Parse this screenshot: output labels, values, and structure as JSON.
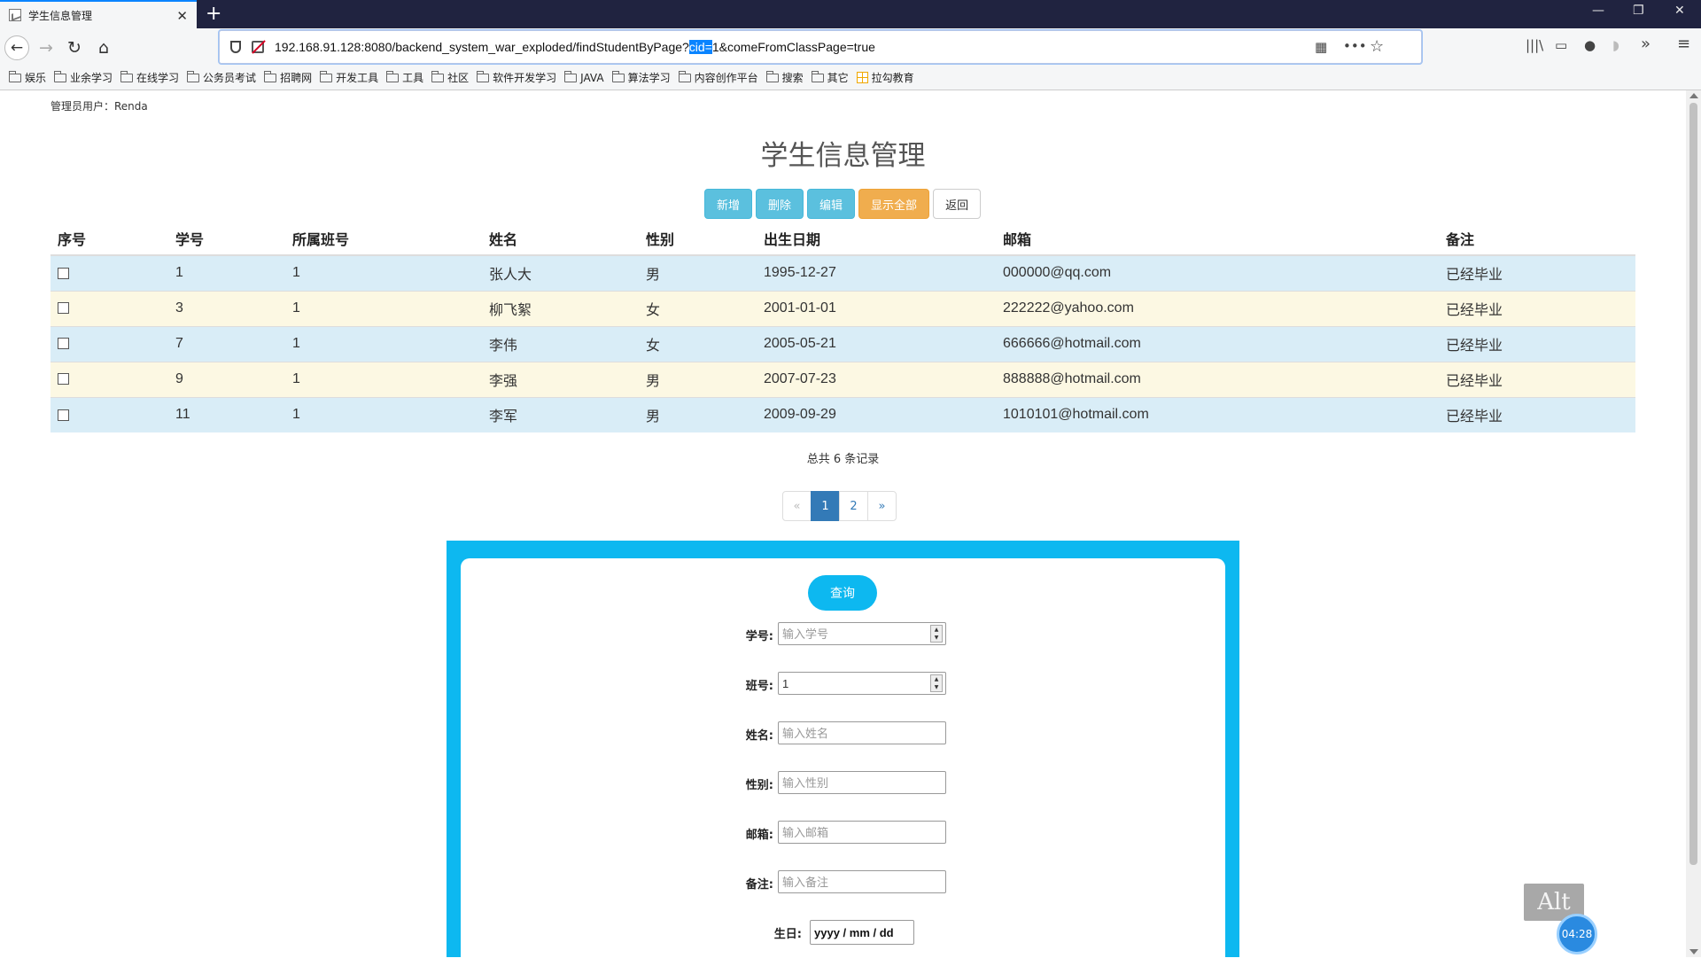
{
  "browser": {
    "tab_title": "学生信息管理",
    "new_tab": "+",
    "tab_close": "✕",
    "url_before": "192.168.91.128:8080/backend_system_war_exploded/findStudentByPage?",
    "url_selected": "cid=",
    "url_after": "1&comeFromClassPage=true",
    "window_controls": {
      "minimize": "—",
      "restore": "❐",
      "close": "✕"
    },
    "nav": {
      "back": "←",
      "forward": "→",
      "reload": "↻",
      "home": "⌂"
    },
    "url_icons": {
      "qr": "▦",
      "more": "•••",
      "star": "☆"
    },
    "right_tools": {
      "library": "|||\\",
      "sidebar": "▭",
      "account": "●",
      "pocket": "◗",
      "overflow": "»",
      "menu": "≡"
    },
    "bookmarks": [
      "娱乐",
      "业余学习",
      "在线学习",
      "公务员考试",
      "招聘网",
      "开发工具",
      "工具",
      "社区",
      "软件开发学习",
      "JAVA",
      "算法学习",
      "内容创作平台",
      "搜索",
      "其它"
    ],
    "bookmark_special": "拉勾教育"
  },
  "page": {
    "admin_label": "管理员用户：Renda",
    "title": "学生信息管理",
    "buttons": {
      "add": "新增",
      "delete": "删除",
      "edit": "编辑",
      "show_all": "显示全部",
      "back": "返回"
    },
    "table": {
      "headers": [
        "序号",
        "学号",
        "所属班号",
        "姓名",
        "性别",
        "出生日期",
        "邮箱",
        "备注"
      ],
      "rows": [
        {
          "id": "1",
          "class_id": "1",
          "name": "张人大",
          "gender": "男",
          "birthday": "1995-12-27",
          "email": "000000@qq.com",
          "remark": "已经毕业"
        },
        {
          "id": "3",
          "class_id": "1",
          "name": "柳飞絮",
          "gender": "女",
          "birthday": "2001-01-01",
          "email": "222222@yahoo.com",
          "remark": "已经毕业"
        },
        {
          "id": "7",
          "class_id": "1",
          "name": "李伟",
          "gender": "女",
          "birthday": "2005-05-21",
          "email": "666666@hotmail.com",
          "remark": "已经毕业"
        },
        {
          "id": "9",
          "class_id": "1",
          "name": "李强",
          "gender": "男",
          "birthday": "2007-07-23",
          "email": "888888@hotmail.com",
          "remark": "已经毕业"
        },
        {
          "id": "11",
          "class_id": "1",
          "name": "李军",
          "gender": "男",
          "birthday": "2009-09-29",
          "email": "1010101@hotmail.com",
          "remark": "已经毕业"
        }
      ]
    },
    "total": "总共 6 条记录",
    "pagination": {
      "prev": "«",
      "pages": [
        "1",
        "2"
      ],
      "current": "1",
      "next": "»"
    },
    "query": {
      "button": "查询",
      "fields": {
        "student_id": {
          "label": "学号:",
          "value": "",
          "placeholder": "输入学号"
        },
        "class_id": {
          "label": "班号:",
          "value": "1",
          "placeholder": ""
        },
        "name": {
          "label": "姓名:",
          "value": "",
          "placeholder": "输入姓名"
        },
        "gender": {
          "label": "性别:",
          "value": "",
          "placeholder": "输入性别"
        },
        "email": {
          "label": "邮箱:",
          "value": "",
          "placeholder": "输入邮箱"
        },
        "remark": {
          "label": "备注:",
          "value": "",
          "placeholder": "输入备注"
        },
        "birthday": {
          "label": "生日:",
          "value": "yyyy / mm / dd"
        }
      }
    }
  },
  "overlay": {
    "alt_key": "Alt",
    "timer": "04:28"
  },
  "colors": {
    "accent": "#0db8f0",
    "info": "#5bc0de",
    "warning": "#f0ad4e",
    "row_info": "#d9edf7",
    "row_warning": "#fcf8e3",
    "primary": "#337ab7"
  }
}
